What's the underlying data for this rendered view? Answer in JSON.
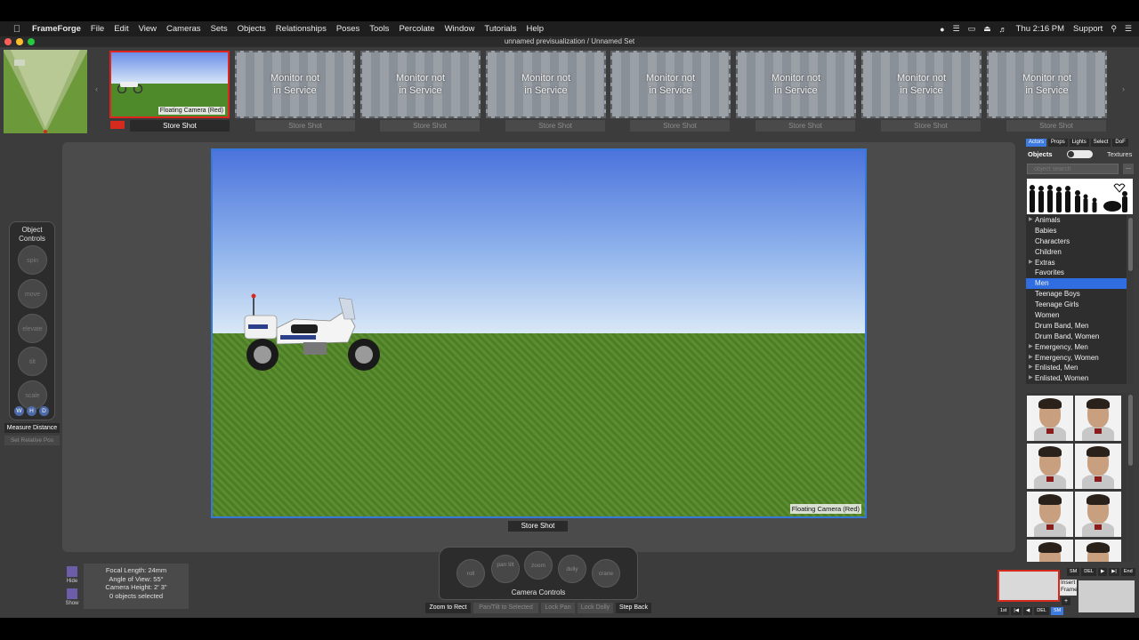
{
  "menubar": {
    "app_name": "FrameForge",
    "items": [
      "File",
      "Edit",
      "View",
      "Cameras",
      "Sets",
      "Objects",
      "Relationships",
      "Poses",
      "Tools",
      "Percolate",
      "Window",
      "Tutorials",
      "Help"
    ],
    "clock": "Thu 2:16 PM",
    "user": "Support"
  },
  "window": {
    "title": "unnamed previsualization / Unnamed Set"
  },
  "shot_strip": {
    "active_camera_label": "Floating Camera (Red)",
    "monitor_text_line1": "Monitor not",
    "monitor_text_line2": "in Service",
    "store_label": "Store Shot"
  },
  "object_controls": {
    "title_line1": "Object",
    "title_line2": "Controls",
    "dials": [
      "spin",
      "move",
      "elevate",
      "tilt",
      "scale"
    ],
    "toggles": [
      "W",
      "H",
      "D"
    ],
    "measure_label": "Measure Distance",
    "set_relative_label": "Set Relative Pos"
  },
  "viewport": {
    "camera_label": "Floating Camera (Red)",
    "store_label": "Store Shot"
  },
  "hide_show": {
    "hide_label": "Hide",
    "show_label": "Show"
  },
  "camera_info": {
    "focal_length": "Focal Length: 24mm",
    "angle_of_view": "Angle of View: 55°",
    "camera_height": "Camera Height: 2' 3\"",
    "selection": "0 objects selected"
  },
  "camera_controls": {
    "title": "Camera Controls",
    "dials": [
      "roll",
      "pan tilt",
      "zoom",
      "dolly",
      "crane"
    ],
    "buttons": [
      {
        "label": "Zoom to Rect",
        "enabled": true
      },
      {
        "label": "Pan/Tilt to Selected",
        "enabled": false
      },
      {
        "label": "Lock Pan",
        "enabled": false
      },
      {
        "label": "Lock Dolly",
        "enabled": false
      },
      {
        "label": "Step Back",
        "enabled": true
      }
    ]
  },
  "right_panel": {
    "tabs": [
      "Actors",
      "Props",
      "Lights",
      "Select",
      "DoF"
    ],
    "active_tab": "Actors",
    "objects_label": "Objects",
    "textures_label": "Textures",
    "search_placeholder": "object search",
    "more_label": "...",
    "categories": [
      {
        "label": "Animals",
        "expandable": true
      },
      {
        "label": "Babies",
        "expandable": false
      },
      {
        "label": "Characters",
        "expandable": false
      },
      {
        "label": "Children",
        "expandable": false
      },
      {
        "label": "Extras",
        "expandable": true
      },
      {
        "label": "Favorites",
        "expandable": false
      },
      {
        "label": "Men",
        "expandable": false,
        "selected": true
      },
      {
        "label": "Teenage Boys",
        "expandable": false
      },
      {
        "label": "Teenage Girls",
        "expandable": false
      },
      {
        "label": "Women",
        "expandable": false
      },
      {
        "label": "Drum Band, Men",
        "expandable": false
      },
      {
        "label": "Drum Band, Women",
        "expandable": false
      },
      {
        "label": "Emergency, Men",
        "expandable": true
      },
      {
        "label": "Emergency, Women",
        "expandable": true
      },
      {
        "label": "Enlisted, Men",
        "expandable": true
      },
      {
        "label": "Enlisted, Women",
        "expandable": true
      }
    ]
  },
  "mini_timeline": {
    "top_buttons": [
      "SM",
      "DEL",
      "▶",
      "▶|",
      "End"
    ],
    "bottom_buttons": [
      "1st",
      "|◀",
      "◀",
      "DEL",
      "SM"
    ],
    "insert_label_line1": "Insert",
    "insert_label_line2": "Frame",
    "plus_label": "+"
  },
  "colors": {
    "accent_blue": "#3d7be0",
    "active_red": "#d72a1f"
  }
}
